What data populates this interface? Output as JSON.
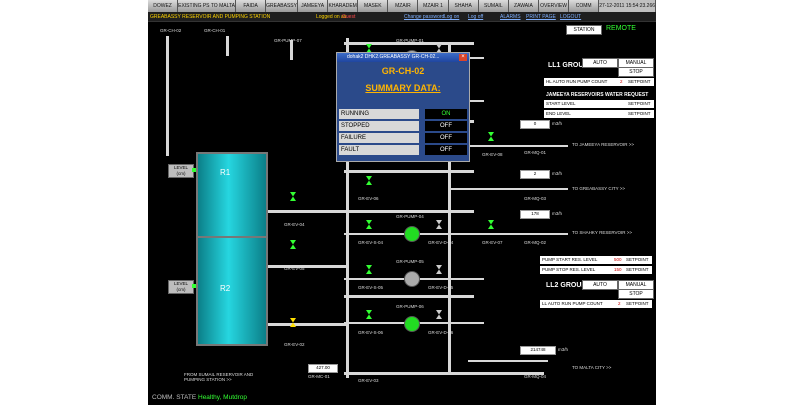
{
  "nav": {
    "items": [
      "DOWEZ",
      "EXISTING PS TO MALTA",
      "FAIDA",
      "GREABASSY",
      "JAMEEYA",
      "KHARADEM",
      "MASEK",
      "MZAIR",
      "MZAIR 1",
      "SHAHA",
      "SUMAIL",
      "ZAWAIA",
      "OVERVIEW",
      "COMM"
    ],
    "datetime": "27-12-2011 15:54:23.266"
  },
  "header": {
    "station_title": "GREABASSY RESERVOIR AND PUMPING STATION",
    "logged_in_label": "Logged on as",
    "user": "Guest",
    "links": [
      "Change password",
      "Log on",
      "Log off",
      "ALARMS",
      "PRINT PAGE",
      "LOGOUT"
    ],
    "station_btn": "STATION",
    "remote": "REMOTE"
  },
  "popup": {
    "window_title": "dohak2 DHK2.GREABASSY GR-CH-02...",
    "tag": "GR-CH-02",
    "summary": "SUMMARY DATA:",
    "rows": [
      {
        "label": "RUNNING",
        "value": "ON"
      },
      {
        "label": "STOPPED",
        "value": "OFF"
      },
      {
        "label": "FAILURE",
        "value": "OFF"
      },
      {
        "label": "FAULT",
        "value": "OFF"
      }
    ]
  },
  "tanks": {
    "r1": "R1",
    "r2": "R2",
    "level_btn": "LEVEL (cm)"
  },
  "tags": {
    "ch02": "GR-CH-02",
    "ch01": "GR-CH-01",
    "pump07": "GR-PUMP-07",
    "ev04": "GR-EV-04",
    "ev05": "GR-EV-05",
    "ev02": "GR-EV-02",
    "pump01": "GR-PUMP-01",
    "pump02": "GR-PUMP-02",
    "pump03": "GR-PUMP-03",
    "pump04": "GR-PUMP-04",
    "pump05": "GR-PUMP-05",
    "pump06": "GR-PUMP-06",
    "evs01": "GR-EV-S-01",
    "evs02": "GR-EV-S-02",
    "evs03": "GR-EV-S-03",
    "evs04": "GR-EV-S-04",
    "evs05": "GR-EV-S-05",
    "evs06": "GR-EV-S-06",
    "evd01": "GR-EV-D-01",
    "evd02": "GR-EV-D-02",
    "evd03": "GR-EV-D-03",
    "evd04": "GR-EV-D-04",
    "evd05": "GR-EV-D-05",
    "evd06": "GR-EV-D-06",
    "ev06": "GR-EV-06",
    "ev07": "GR-EV-07",
    "ev08": "GR-EV-08",
    "ev03": "GR-EV-03",
    "mq01": "GR-MQ-01",
    "mq02": "GR-MQ-02",
    "mq03": "GR-MQ-03",
    "mq04": "GR-MQ-04",
    "mc01": "GR-MC-01"
  },
  "flows": {
    "f1": "0",
    "f2": "2",
    "f3": "178",
    "f4": "214748",
    "mc01": "427.00",
    "unit": "m3/h",
    "to_jameeya": "TO JAMEEYA RESERVOIR >>",
    "to_greabassy": "TO GREABASSY CITY >>",
    "to_shahky": "TO SHAHKY RESERVOIR >>",
    "to_malta": "TO MALTA CITY >>",
    "from_sumail": "FROM SUMAIL RESERVOIR AND PUMPING STATION >>"
  },
  "ll1": {
    "group": "LL1 GROUP",
    "auto": "AUTO",
    "manual": "MANUAL",
    "state": "STOP",
    "pump_count_label": "HL AUTO RUN PUMP COUNT",
    "pump_count": "2",
    "setpoint": "SETPOINT",
    "water_req": "JAMEEYA RESERVOIRS WATER REQUEST",
    "start_level": "START LEVEL",
    "end_level": "END LEVEL"
  },
  "ll2": {
    "start_label": "PUMP START RES. LEVEL",
    "start_val": "500",
    "stop_label": "PUMP STOP RES. LEVEL",
    "stop_val": "150",
    "group": "LL2 GROUP",
    "auto": "AUTO",
    "manual": "MANUAL",
    "state": "STOP",
    "pump_count_label": "LL AUTO RUN PUMP COUNT",
    "pump_count": "2",
    "setpoint": "SETPOINT"
  },
  "status": {
    "label": "COMM. STATE",
    "value": "Healthy, Mutdrop"
  }
}
